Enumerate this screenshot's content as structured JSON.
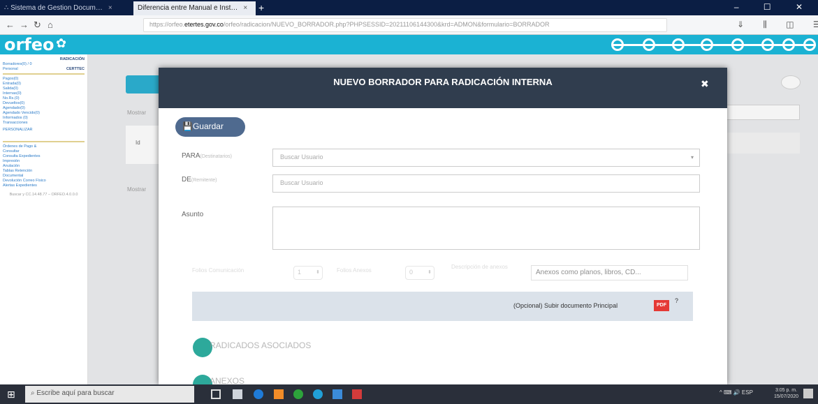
{
  "browser": {
    "tab1_title": "∴ Sistema de Gestion Docum…",
    "tab2_title": "Diferencia entre Manual e Inst…",
    "tab_close": "×",
    "new_tab": "+",
    "window_controls": "–  ☐  ✕",
    "url_prefix": "https://orfeo.",
    "url_domain": "etertes.gov.co",
    "url_rest": "/orfeo/radicacion/NUEVO_BORRADOR.php?PHPSESSID=20211106144300&krd=ADMON&formulario=BORRADOR"
  },
  "app": {
    "logo": "orfeo",
    "accent": "#1bb2d3"
  },
  "sidebar": {
    "header": "RADICACIÓN",
    "user": "Borradores(0) / 0",
    "tabs": [
      "Personal",
      "CERTTEC"
    ],
    "folders": [
      "Pagos(0)",
      "Entrada(0)",
      "Salida(0)",
      "Internas(0)",
      "No.Rs.(0)",
      "Devueltos(0)",
      "Agendado(0)",
      "Agendado Vencido(0)",
      "Informados (0)",
      "Transacciones"
    ],
    "personal": "PERSONALIZAR",
    "menu": [
      "Órdenes de Pago &",
      "Consultar",
      "Consulta Expedientes",
      "Impresión",
      "Anulación",
      "Tablas Retención",
      "Documental",
      "Devolución Correo Físico",
      "Alertas Expedientes"
    ],
    "footer": "Buscar y CC.14.48.77 – ORFEO.4.0.0.0"
  },
  "background": {
    "label1": "Mostrar",
    "label2": "Mostrar",
    "col": "Id"
  },
  "modal": {
    "title": "NUEVO BORRADOR PARA RADICACIÓN INTERNA",
    "close": "✖",
    "save_label": "💾Guardar",
    "para_label": "PARA",
    "para_sub": "(Destinatarios)",
    "para_placeholder": "Buscar Usuario",
    "de_label": "DE",
    "de_sub": "(Remitente)",
    "de_placeholder": "Buscar Usuario",
    "asunto_label": "Asunto",
    "folios_label": "Folios Comunicación",
    "folios_value": "1",
    "anexos_label": "Folios Anexos",
    "anexos_value": "0",
    "anexdesc_label": "Descripción de anexos",
    "anexdesc_value": "Anexos como planos, libros, CD...",
    "upload_text": "(Opcional) Subir documento Principal",
    "pdf_badge": "PDF",
    "upload_sup": "?",
    "radicados_label": "RADICADOS ASOCIADOS",
    "anexos_section": "ANEXOS"
  },
  "taskbar": {
    "start": "⊞",
    "search": "Escribe aquí para buscar",
    "tray": "^  ⌨  🔊  ESP",
    "time": "3:05 p. m.",
    "date": "15/07/2020"
  }
}
